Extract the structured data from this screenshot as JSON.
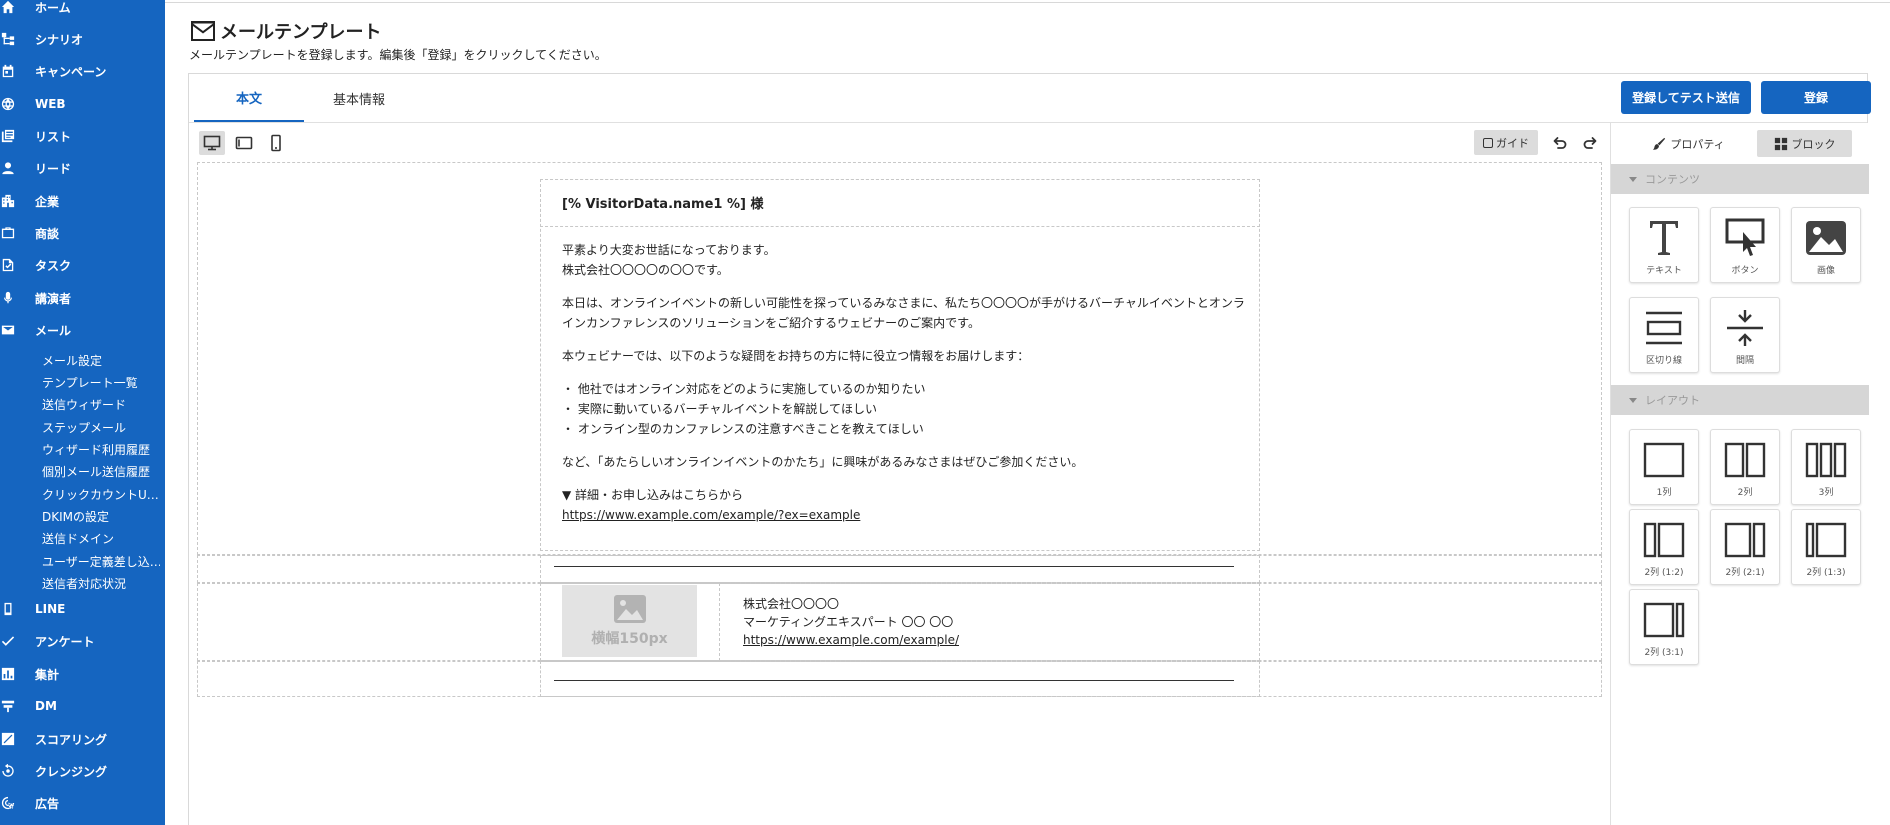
{
  "sidebar": {
    "nav": [
      {
        "label": "ホーム",
        "icon": "home-icon"
      },
      {
        "label": "シナリオ",
        "icon": "scenario-icon"
      },
      {
        "label": "キャンペーン",
        "icon": "calendar-icon"
      },
      {
        "label": "WEB",
        "icon": "globe-icon"
      },
      {
        "label": "リスト",
        "icon": "list-icon"
      },
      {
        "label": "リード",
        "icon": "person-icon"
      },
      {
        "label": "企業",
        "icon": "building-icon"
      },
      {
        "label": "商談",
        "icon": "briefcase-icon"
      },
      {
        "label": "タスク",
        "icon": "task-icon"
      },
      {
        "label": "講演者",
        "icon": "microphone-icon"
      },
      {
        "label": "メール",
        "icon": "mail-icon"
      }
    ],
    "mail_sub": [
      "メール設定",
      "テンプレート一覧",
      "送信ウィザード",
      "ステップメール",
      "ウィザード利用履歴",
      "個別メール送信履歴",
      "クリックカウントU…",
      "DKIMの設定",
      "送信ドメイン",
      "ユーザー定義差し込…",
      "送信者対応状況"
    ],
    "nav_bottom": [
      {
        "label": "LINE",
        "icon": "phone-icon"
      },
      {
        "label": "アンケート",
        "icon": "check-icon"
      },
      {
        "label": "集計",
        "icon": "chart-icon"
      },
      {
        "label": "DM",
        "icon": "signpost-icon"
      },
      {
        "label": "スコアリング",
        "icon": "scoring-icon"
      },
      {
        "label": "クレンジング",
        "icon": "cleansing-icon"
      },
      {
        "label": "広告",
        "icon": "ads-icon"
      }
    ]
  },
  "header": {
    "title": "メールテンプレート",
    "description": "メールテンプレートを登録します。編集後「登録」をクリックしてください。"
  },
  "tabs": [
    "本文",
    "基本情報"
  ],
  "actions": {
    "register_and_test": "登録してテスト送信",
    "register": "登録"
  },
  "toolbar": {
    "guide": "ガイド"
  },
  "email": {
    "greeting": "[% VisitorData.name1 %] 様",
    "para1_l1": "平素より大変お世話になっております。",
    "para1_l2": "株式会社〇〇〇〇の〇〇です。",
    "para2_l1": "本日は、オンラインイベントの新しい可能性を探っているみなさまに、私たち〇〇〇〇が手がけるバーチャルイベントとオンラ",
    "para2_l2": "インカンファレンスのソリューションをご紹介するウェビナーのご案内です。",
    "para3": "本ウェビナーでは、以下のような疑問をお持ちの方に特に役立つ情報をお届けします：",
    "bullet1": "・ 他社ではオンライン対応をどのように実施しているのか知りたい",
    "bullet2": "・ 実際に動いているバーチャルイベントを解説してほしい",
    "bullet3": "・ オンライン型のカンファレンスの注意すべきことを教えてほしい",
    "para4": "など、「あたらしいオンラインイベントのかたち」に興味があるみなさまはぜひご参加ください。",
    "link_label": "▼ 詳細・お申し込みはこちらから",
    "link_url": "https://www.example.com/example/?ex=example",
    "image_placeholder": "横幅150px",
    "sig_company": "株式会社〇〇〇〇",
    "sig_title": "マーケティングエキスパート 〇〇 〇〇",
    "sig_url": "https://www.example.com/example/"
  },
  "side_panel": {
    "tab_property": "プロパティ",
    "tab_block": "ブロック",
    "section_contents": "コンテンツ",
    "section_layout": "レイアウト",
    "content_blocks": [
      "テキスト",
      "ボタン",
      "画像",
      "区切り線",
      "間隔"
    ],
    "layout_blocks": [
      "1列",
      "2列",
      "3列",
      "2列 (1:2)",
      "2列 (2:1)",
      "2列 (1:3)",
      "2列 (3:1)"
    ]
  },
  "colors": {
    "sidebar": "#1565c0",
    "primary": "#1565c0"
  }
}
